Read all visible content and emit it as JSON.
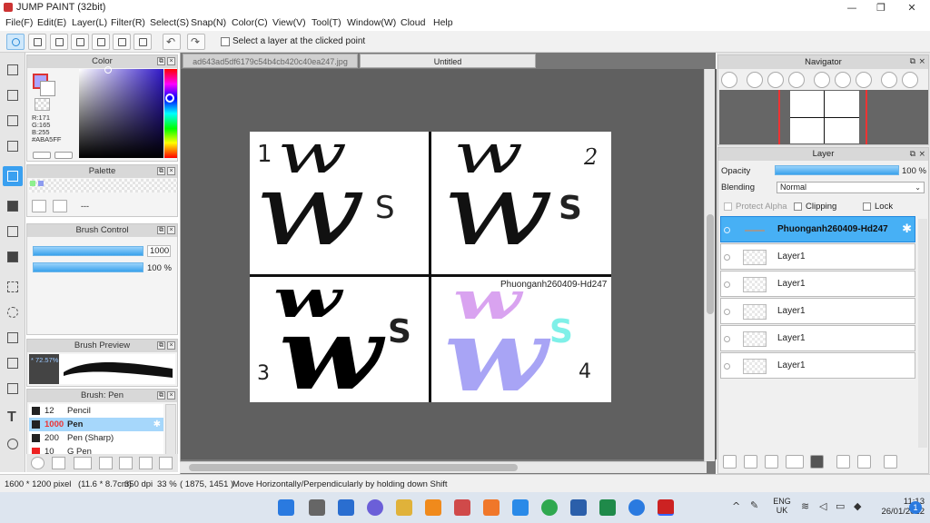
{
  "window": {
    "title": "JUMP PAINT (32bit)",
    "minimize": "—",
    "maximize": "❐",
    "close": "✕"
  },
  "menu": [
    "File(F)",
    "Edit(E)",
    "Layer(L)",
    "Filter(R)",
    "Select(S)",
    "Snap(N)",
    "Color(C)",
    "View(V)",
    "Tool(T)",
    "Window(W)",
    "Cloud",
    "Help"
  ],
  "toolbar": {
    "select_layer_label": "Select a layer at the clicked point"
  },
  "color_panel": {
    "title": "Color",
    "rgb_r": "R:171",
    "rgb_g": "G:165",
    "rgb_b": "B:255",
    "hex": "#ABA5FF",
    "foreground_color": "#ABA5FF"
  },
  "palette_panel": {
    "title": "Palette",
    "name": "---"
  },
  "brush_control": {
    "title": "Brush Control",
    "size_value": "1000",
    "opacity_value": "100 %"
  },
  "brush_preview": {
    "title": "Brush Preview",
    "label": "* 72.57%"
  },
  "brush_list": {
    "title": "Brush: Pen",
    "items": [
      {
        "size": "12",
        "name": "Pencil"
      },
      {
        "size": "1000",
        "name": "Pen"
      },
      {
        "size": "200",
        "name": "Pen (Sharp)"
      },
      {
        "size": "10",
        "name": "G Pen"
      }
    ]
  },
  "doc_tabs": [
    "ad643ad5df6179c54b4cb420c40ea247.jpg",
    "Untitled"
  ],
  "canvas": {
    "labels": [
      "1",
      "2",
      "3",
      "4"
    ],
    "quadrant_glyphs": [
      "w",
      "S"
    ],
    "watermark": "Phuonganh260409-Hd247"
  },
  "statusbar": {
    "size": "1600 * 1200 pixel",
    "physical": "(11.6 * 8.7cm)",
    "dpi": "350 dpi",
    "zoom": "33 %",
    "coords": "( 1875, 1451 )",
    "hint": "Move Horizontally/Perpendicularly by holding down Shift"
  },
  "navigator": {
    "title": "Navigator"
  },
  "layer_panel": {
    "title": "Layer",
    "opacity_label": "Opacity",
    "opacity_value": "100 %",
    "blending_label": "Blending",
    "blending_value": "Normal",
    "protect_alpha": "Protect Alpha",
    "clipping": "Clipping",
    "lock": "Lock",
    "layers": [
      "Phuonganh260409-Hd247",
      "Layer1",
      "Layer1",
      "Layer1",
      "Layer1",
      "Layer1"
    ]
  },
  "tray": {
    "lang1": "ENG",
    "lang2": "UK",
    "time": "11:13",
    "date": "26/01/2022",
    "notifications": "1"
  }
}
